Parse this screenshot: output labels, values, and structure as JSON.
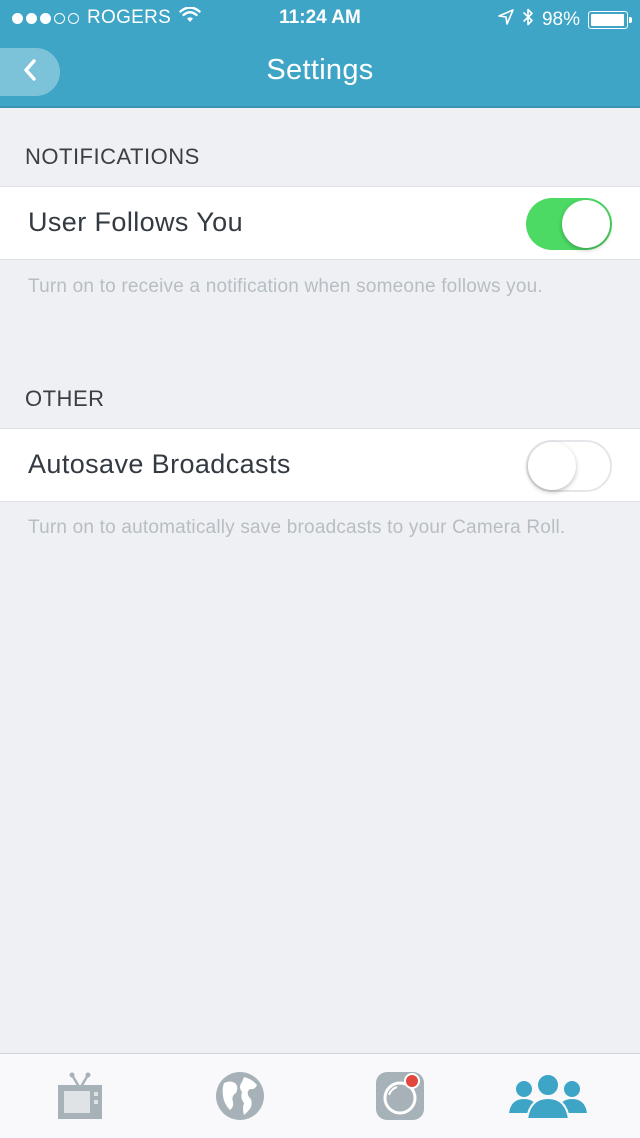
{
  "status_bar": {
    "carrier": "ROGERS",
    "time": "11:24 AM",
    "battery": "98%",
    "battery_level": 0.98,
    "signal_bars_filled": 3,
    "signal_bars_total": 5
  },
  "nav": {
    "title": "Settings",
    "back_icon": "chevron-left-icon"
  },
  "sections": {
    "notifications": {
      "header": "NOTIFICATIONS",
      "row_label": "User Follows You",
      "toggle_on": true,
      "footer": "Turn on to receive a notification when someone follows you."
    },
    "other": {
      "header": "OTHER",
      "row_label": "Autosave Broadcasts",
      "toggle_on": false,
      "footer": "Turn on to automatically save broadcasts to your Camera Roll."
    }
  },
  "tab_bar": {
    "tabs": [
      {
        "icon": "tv-icon",
        "active": false
      },
      {
        "icon": "globe-icon",
        "active": false
      },
      {
        "icon": "camera-icon",
        "active": false
      },
      {
        "icon": "people-icon",
        "active": true
      }
    ]
  },
  "colors": {
    "header": "#3fa5c6",
    "toggle_on": "#4cd964",
    "active_tab": "#3fa5c6",
    "inactive_tab": "#a7b1b8",
    "record_dot": "#e2473c"
  }
}
